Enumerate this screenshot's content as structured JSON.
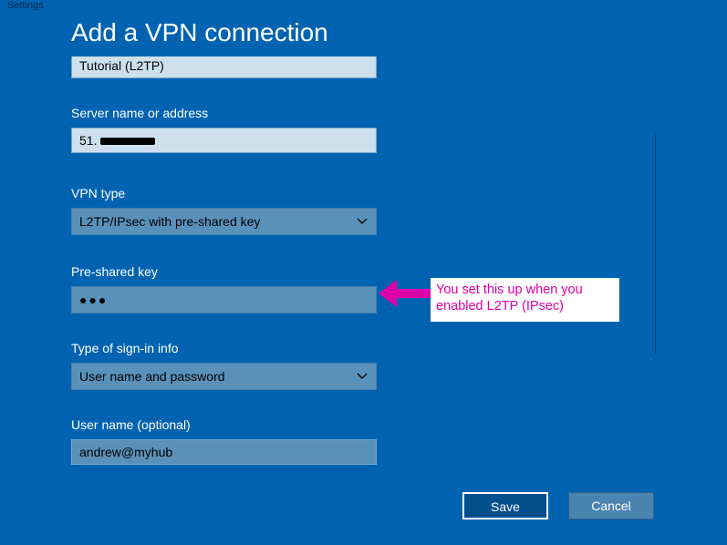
{
  "app_title": "Settings",
  "page_title": "Add a VPN connection",
  "connection_name_value": "Tutorial (L2TP)",
  "labels": {
    "server": "Server name or address",
    "vpn_type": "VPN type",
    "psk": "Pre-shared key",
    "signin": "Type of sign-in info",
    "username": "User name (optional)"
  },
  "values": {
    "server": "51.",
    "vpn_type": "L2TP/IPsec with pre-shared key",
    "psk_mask": "●●●",
    "signin": "User name and password",
    "username": "andrew@myhub"
  },
  "buttons": {
    "save": "Save",
    "cancel": "Cancel"
  },
  "annotation": "You set this up when you enabled L2TP (IPsec)"
}
